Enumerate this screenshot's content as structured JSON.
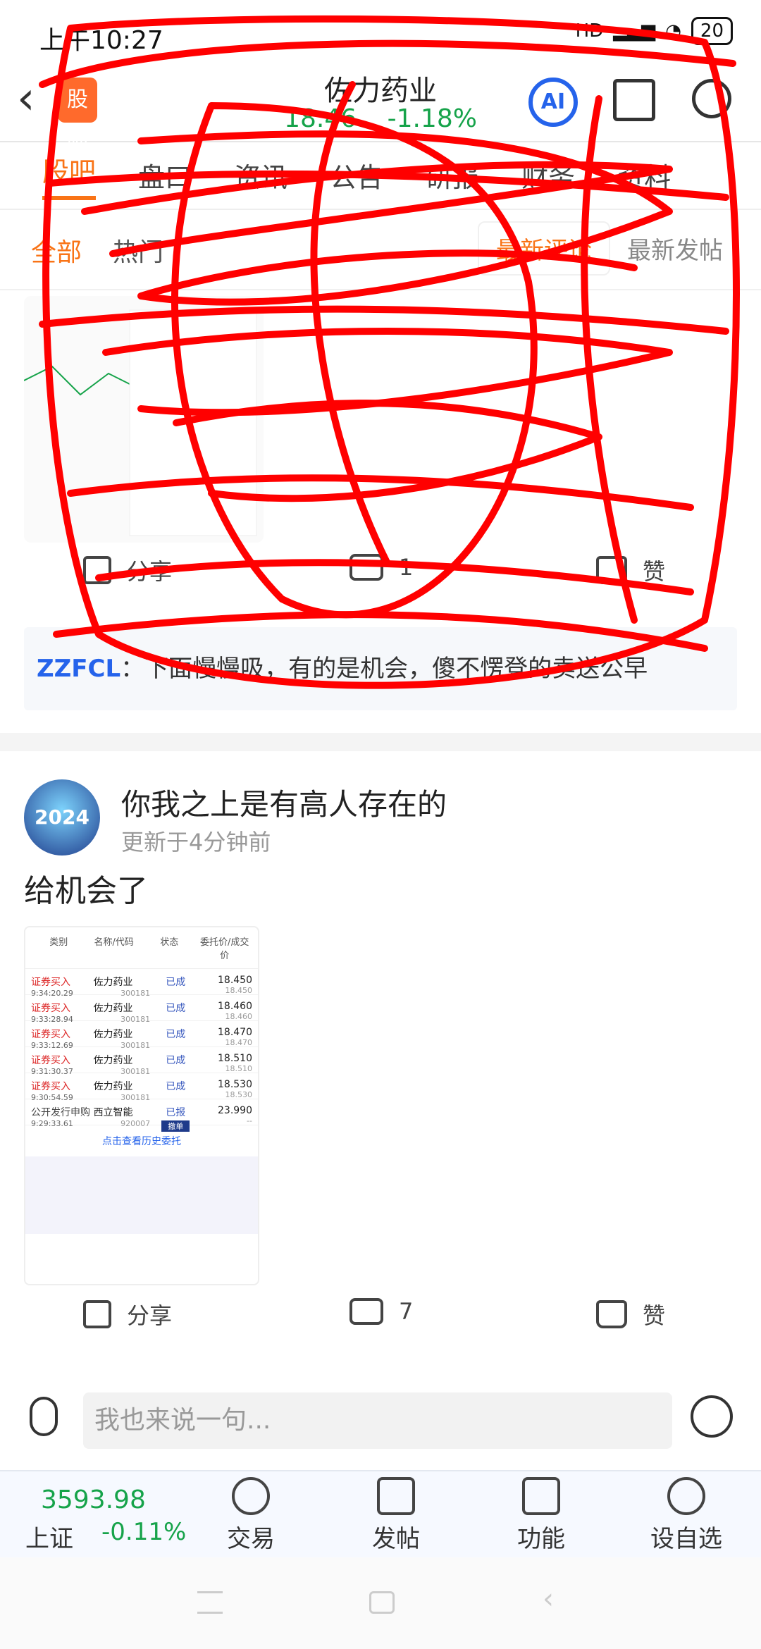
{
  "status_bar": {
    "time": "上午10:27",
    "hd": "HD",
    "battery": "20"
  },
  "header": {
    "brand_badge": "股吧",
    "title": "佐力药业",
    "price": "18.46",
    "change": "-1.18%",
    "ai_label": "AI"
  },
  "tabs": [
    "股吧",
    "盘口",
    "资讯",
    "公告",
    "研报",
    "财务",
    "资料"
  ],
  "subtabs": [
    "全部",
    "热门"
  ],
  "sort_options": [
    "最新评论",
    "最新发帖"
  ],
  "post1": {
    "actions": {
      "share": "分享",
      "comments": "1",
      "like": "赞"
    },
    "reply": {
      "user": "ZZFCL",
      "text": "：下面慢慢吸，有的是机会，傻不愣登的卖送公早"
    }
  },
  "post2": {
    "author": "你我之上是有高人存在的",
    "avatar_text": "2024",
    "updated": "更新于4分钟前",
    "content": "给机会了",
    "screenshot": {
      "headers": [
        "类别",
        "名称/代码",
        "状态",
        "委托价/成交价"
      ],
      "rows": [
        {
          "type": "证券买入",
          "time": "9:34:20.29",
          "name": "佐力药业",
          "code": "300181",
          "status": "已成",
          "price": "18.450",
          "deal": "18.450"
        },
        {
          "type": "证券买入",
          "time": "9:33:28.94",
          "name": "佐力药业",
          "code": "300181",
          "status": "已成",
          "price": "18.460",
          "deal": "18.460"
        },
        {
          "type": "证券买入",
          "time": "9:33:12.69",
          "name": "佐力药业",
          "code": "300181",
          "status": "已成",
          "price": "18.470",
          "deal": "18.470"
        },
        {
          "type": "证券买入",
          "time": "9:31:30.37",
          "name": "佐力药业",
          "code": "300181",
          "status": "已成",
          "price": "18.510",
          "deal": "18.510"
        },
        {
          "type": "证券买入",
          "time": "9:30:54.59",
          "name": "佐力药业",
          "code": "300181",
          "status": "已成",
          "price": "18.530",
          "deal": "18.530"
        },
        {
          "type": "公开发行申购",
          "time": "9:29:33.61",
          "name": "西立智能",
          "code": "920007",
          "status": "已报",
          "price": "23.990",
          "deal": "--"
        }
      ],
      "cancel_label": "撤单",
      "link": "点击查看历史委托"
    },
    "actions": {
      "share": "分享",
      "comments": "7",
      "like": "赞"
    }
  },
  "comment_input": {
    "placeholder": "我也来说一句..."
  },
  "bottom_nav": {
    "index_value": "3593.98",
    "index_name": "上证",
    "index_change": "-0.11%",
    "items": [
      "交易",
      "发帖",
      "功能",
      "设自选"
    ]
  },
  "colors": {
    "accent": "#f97316",
    "down": "#16a34a",
    "link": "#2563eb",
    "scribble": "#ff0000"
  }
}
